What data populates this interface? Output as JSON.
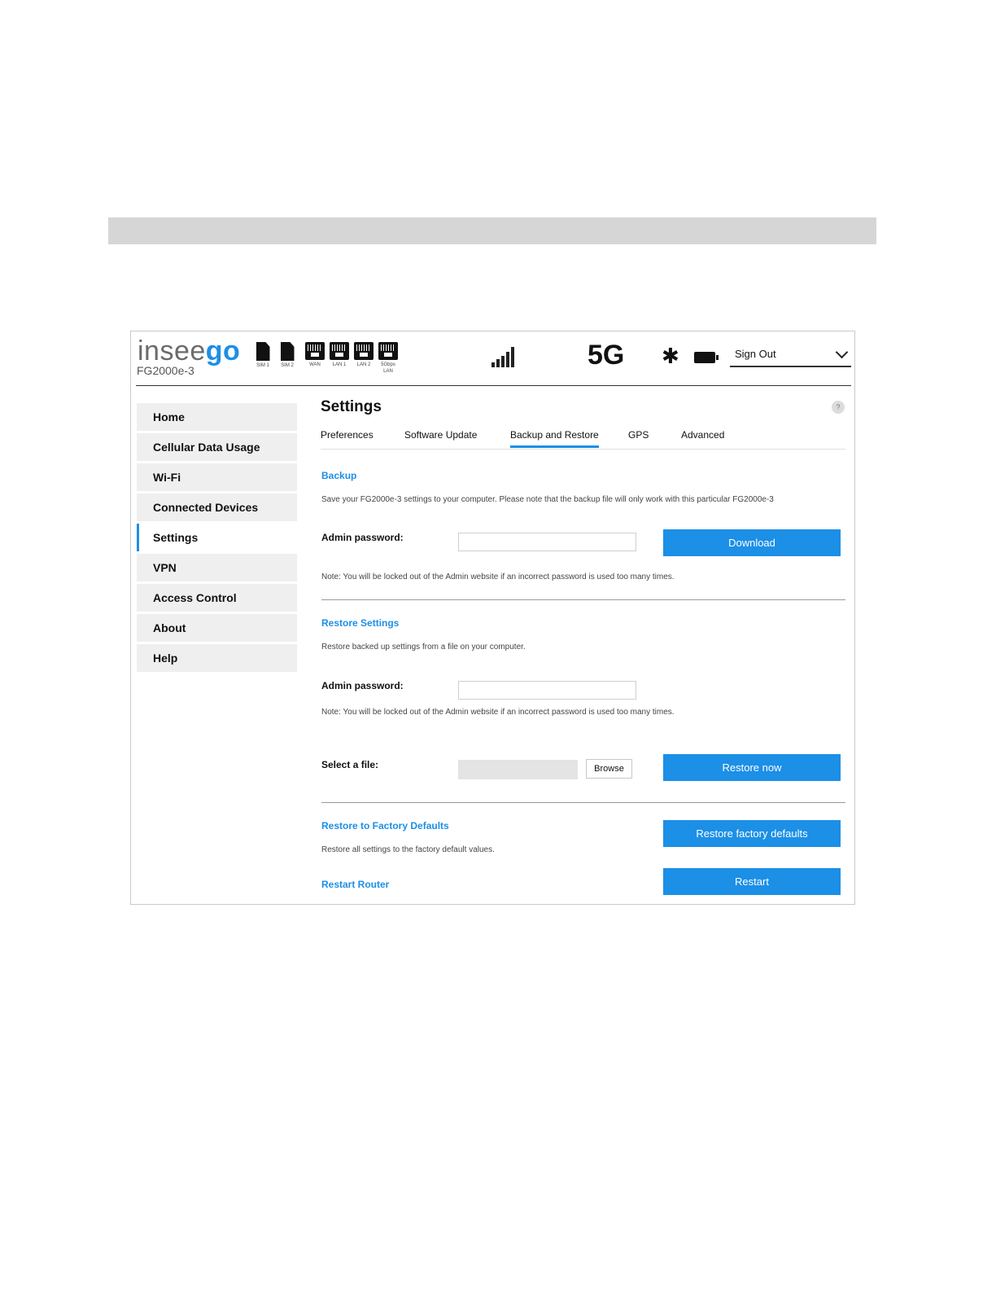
{
  "brand": {
    "logo_part1": "insee",
    "logo_part2": "go",
    "model": "FG2000e-3"
  },
  "status": {
    "icons": [
      {
        "name": "sim-1-icon",
        "kind": "sim",
        "label": "SIM 1"
      },
      {
        "name": "sim-2-icon",
        "kind": "sim",
        "label": "SIM 2"
      },
      {
        "name": "wan-port-icon",
        "kind": "eth",
        "label": "WAN"
      },
      {
        "name": "lan1-port-icon",
        "kind": "eth",
        "label": "LAN 1"
      },
      {
        "name": "lan2-port-icon",
        "kind": "eth",
        "label": "LAN 2"
      },
      {
        "name": "lan-5gbps-port-icon",
        "kind": "eth",
        "label": "5Gbps LAN"
      }
    ],
    "network": "5G",
    "bluetooth_glyph": "✱"
  },
  "account": {
    "signout_label": "Sign Out"
  },
  "sidebar": {
    "items": [
      {
        "label": "Home"
      },
      {
        "label": "Cellular Data Usage"
      },
      {
        "label": "Wi-Fi"
      },
      {
        "label": "Connected Devices"
      },
      {
        "label": "Settings"
      },
      {
        "label": "VPN"
      },
      {
        "label": "Access Control"
      },
      {
        "label": "About"
      },
      {
        "label": "Help"
      }
    ],
    "active": "Settings"
  },
  "page": {
    "title": "Settings",
    "help": "?"
  },
  "tabs": [
    {
      "label": "Preferences"
    },
    {
      "label": "Software Update"
    },
    {
      "label": "Backup and Restore"
    },
    {
      "label": "GPS"
    },
    {
      "label": "Advanced"
    }
  ],
  "active_tab": "Backup and Restore",
  "backup": {
    "title": "Backup",
    "description": "Save your FG2000e-3 settings to your computer. Please note that the backup file will only work with this particular FG2000e-3",
    "password_label": "Admin password:",
    "password_value": "",
    "button": "Download",
    "note": "Note: You will be locked out of the Admin website if an incorrect password is used too many times."
  },
  "restore": {
    "title": "Restore Settings",
    "description": "Restore backed up settings from a file on your computer.",
    "password_label": "Admin password:",
    "password_value": "",
    "note": "Note: You will be locked out of the Admin website if an incorrect password is used too many times.",
    "file_label": "Select a file:",
    "browse_label": "Browse",
    "button": "Restore now"
  },
  "factory": {
    "title": "Restore to Factory Defaults",
    "description": "Restore all settings to the factory default values.",
    "button": "Restore factory defaults"
  },
  "restart": {
    "title": "Restart Router",
    "button": "Restart"
  },
  "colors": {
    "accent": "#1c8fe6",
    "nav_bg": "#efefef",
    "top_bar": "#d6d6d6"
  }
}
